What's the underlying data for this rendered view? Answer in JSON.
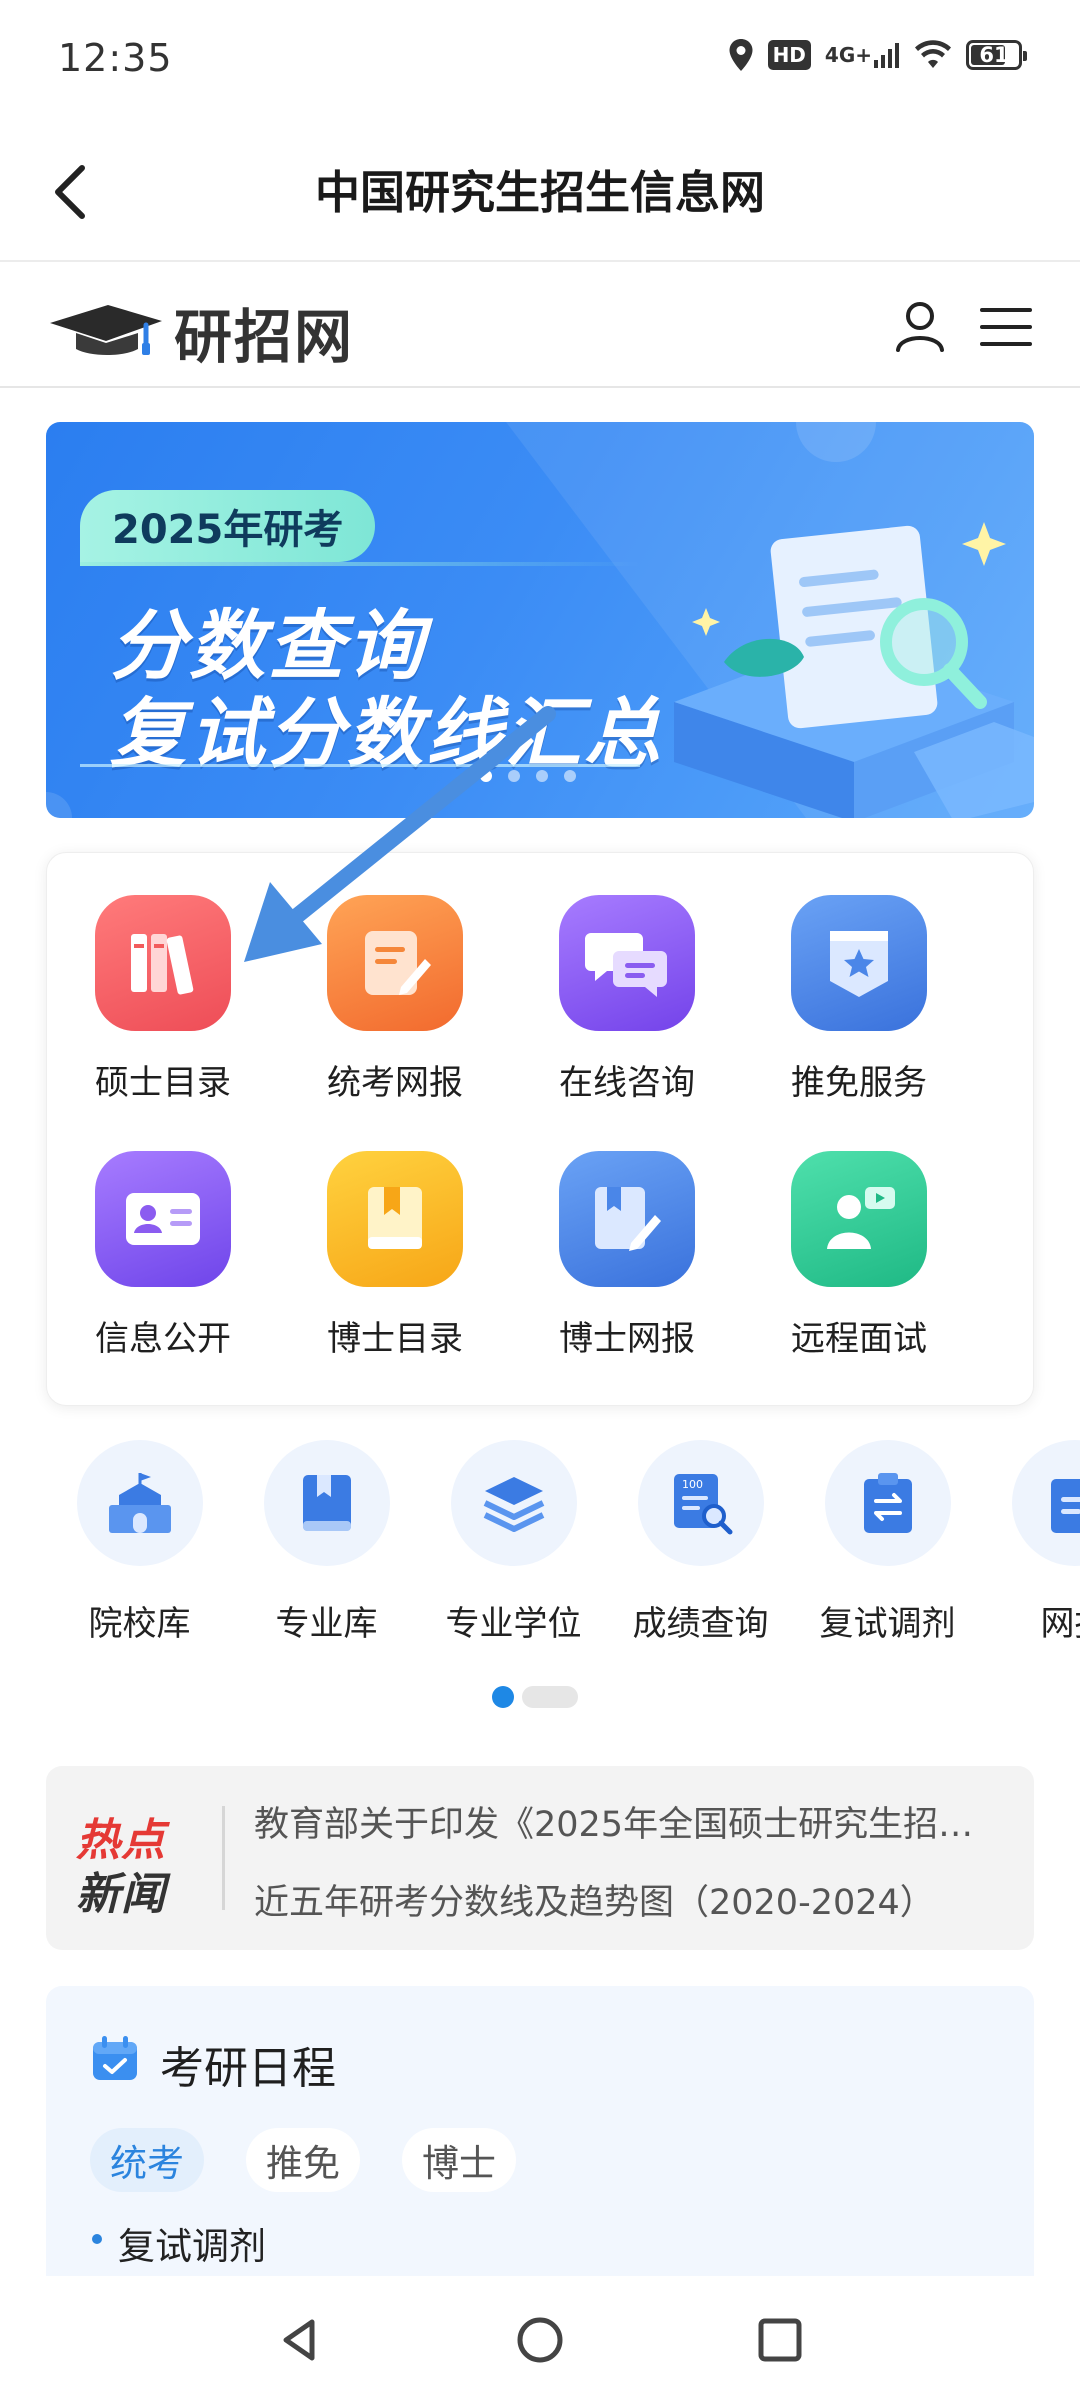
{
  "status_bar": {
    "time": "12:35",
    "hd": "HD",
    "network": "4G+",
    "battery": "61"
  },
  "app": {
    "title": "中国研究生招生信息网"
  },
  "site_header": {
    "logo_text": "研招网"
  },
  "banner": {
    "tag": "2025年研考",
    "line1": "分数查询",
    "line2": "复试分数线汇总"
  },
  "quick_grid": [
    {
      "label": "硕士目录",
      "icon": "books-icon",
      "color": "#f25c5c"
    },
    {
      "label": "统考网报",
      "icon": "edit-document-icon",
      "color": "#f5873a"
    },
    {
      "label": "在线咨询",
      "icon": "chat-bubbles-icon",
      "color": "#8a5cf0"
    },
    {
      "label": "推免服务",
      "icon": "star-badge-icon",
      "color": "#4b86e8"
    },
    {
      "label": "信息公开",
      "icon": "id-card-icon",
      "color": "#8b5cf0"
    },
    {
      "label": "博士目录",
      "icon": "bookmark-book-icon",
      "color": "#f8b623"
    },
    {
      "label": "博士网报",
      "icon": "book-edit-icon",
      "color": "#4a86e8"
    },
    {
      "label": "远程面试",
      "icon": "video-interview-icon",
      "color": "#2ecb96"
    }
  ],
  "secondary_row": [
    {
      "label": "院校库",
      "icon": "school-icon"
    },
    {
      "label": "专业库",
      "icon": "book-icon"
    },
    {
      "label": "专业学位",
      "icon": "layers-icon"
    },
    {
      "label": "成绩查询",
      "icon": "score-search-icon"
    },
    {
      "label": "复试调剂",
      "icon": "clipboard-swap-icon"
    },
    {
      "label": "网报",
      "icon": "report-icon"
    }
  ],
  "news": {
    "badge_line1": "热点",
    "badge_line2": "新闻",
    "items": [
      "教育部关于印发《2025年全国硕士研究生招…",
      "近五年研考分数线及趋势图（2020-2024）"
    ]
  },
  "schedule": {
    "title": "考研日程",
    "tabs": [
      "统考",
      "推免",
      "博士"
    ],
    "active_tab": "统考",
    "first_item": "复试调剂"
  },
  "colors": {
    "accent": "#1e88e5",
    "banner_blue": "#2b7ef0",
    "arrow": "#4a8ee0"
  }
}
